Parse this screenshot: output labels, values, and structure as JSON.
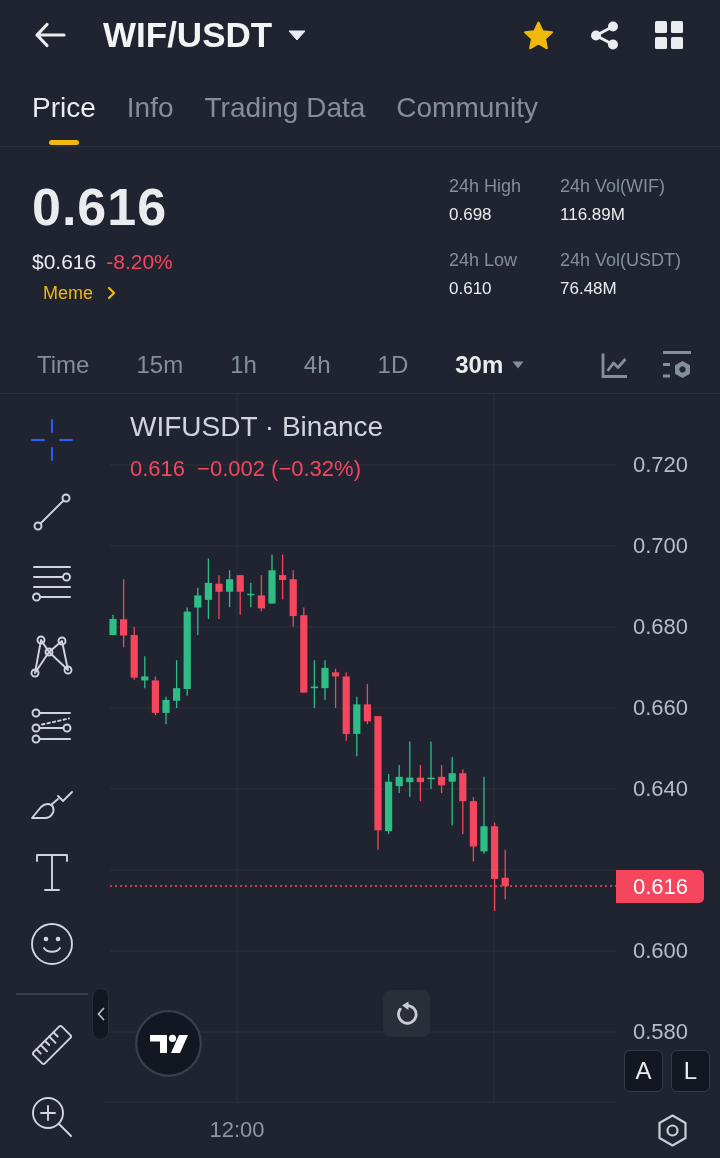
{
  "header": {
    "pair": "WIF/USDT",
    "favorite": true
  },
  "tabs": [
    {
      "label": "Price",
      "selected": true
    },
    {
      "label": "Info",
      "selected": false
    },
    {
      "label": "Trading Data",
      "selected": false
    },
    {
      "label": "Community",
      "selected": false
    }
  ],
  "ticker": {
    "last_price": "0.616",
    "usd_price": "$0.616",
    "change": "-8.20%",
    "category": "Meme"
  },
  "stats": [
    {
      "label": "24h High",
      "value": "0.698"
    },
    {
      "label": "24h Vol(WIF)",
      "value": "116.89M"
    },
    {
      "label": "24h Low",
      "value": "0.610"
    },
    {
      "label": "24h Vol(USDT)",
      "value": "76.48M"
    }
  ],
  "intervals": [
    {
      "label": "Time",
      "selected": false,
      "menu": false
    },
    {
      "label": "15m",
      "selected": false,
      "menu": false
    },
    {
      "label": "1h",
      "selected": false,
      "menu": false
    },
    {
      "label": "4h",
      "selected": false,
      "menu": false
    },
    {
      "label": "1D",
      "selected": false,
      "menu": false
    },
    {
      "label": "30m",
      "selected": true,
      "menu": true
    }
  ],
  "drawing_tools": [
    {
      "selected": true
    },
    {
      "selected": false
    },
    {
      "selected": false
    },
    {
      "selected": false
    },
    {
      "selected": false
    },
    {
      "selected": false
    },
    {
      "selected": false
    },
    {
      "selected": false
    }
  ],
  "chart": {
    "title": "WIFUSDT · Binance",
    "last_price": "0.616",
    "change": "−0.002 (−0.32%)",
    "y_axis_labels": [
      "0.720",
      "0.700",
      "0.680",
      "0.660",
      "0.640",
      "0.600",
      "0.580"
    ],
    "current_price": "0.616",
    "x_axis_labels": [
      "12:00"
    ],
    "scale_buttons": [
      "A",
      "L"
    ]
  }
}
